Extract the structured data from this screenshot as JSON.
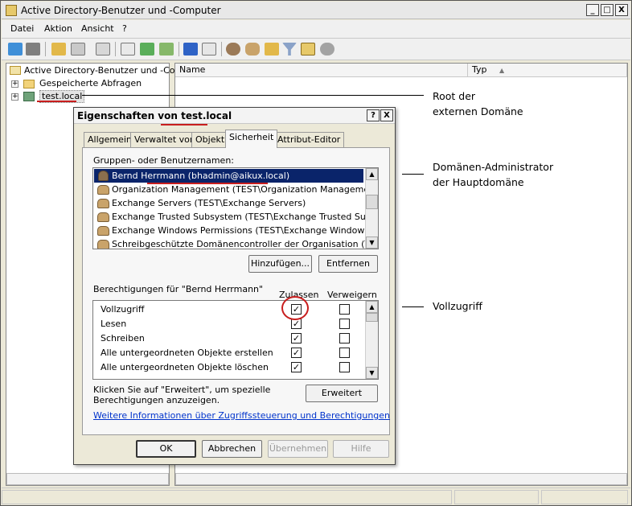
{
  "window": {
    "title": "Active Directory-Benutzer und -Computer",
    "min": "_",
    "max": "□",
    "close": "X"
  },
  "menu": [
    "Datei",
    "Aktion",
    "Ansicht",
    "?"
  ],
  "tree": {
    "root": "Active Directory-Benutzer und -Comp",
    "saved": "Gespeicherte Abfragen",
    "domain": "test.local"
  },
  "list": {
    "col_name": "Name",
    "col_type": "Typ"
  },
  "annotations": {
    "root_line1": "Root der",
    "root_line2": "externen Domäne",
    "admin_line1": "Domänen-Administrator",
    "admin_line2": "der Hauptdomäne",
    "full": "Vollzugriff"
  },
  "dialog": {
    "title": "Eigenschaften von test.local",
    "help": "?",
    "close": "X",
    "tabs": [
      "Allgemein",
      "Verwaltet von",
      "Objekt",
      "Sicherheit",
      "Attribut-Editor"
    ],
    "active_tab": "Sicherheit",
    "users_label": "Gruppen- oder Benutzernamen:",
    "users": [
      {
        "name": "Bernd Herrmann (bhadmin@aikux.local)",
        "kind": "user",
        "selected": true
      },
      {
        "name": "Organization Management (TEST\\Organization Management)",
        "kind": "group"
      },
      {
        "name": "Exchange Servers (TEST\\Exchange Servers)",
        "kind": "group"
      },
      {
        "name": "Exchange Trusted Subsystem (TEST\\Exchange Trusted Subsy...",
        "kind": "group"
      },
      {
        "name": "Exchange Windows Permissions (TEST\\Exchange Windows Pe...",
        "kind": "group"
      },
      {
        "name": "Schreibgeschützte Domänencontroller der Organisation (TEST\\...",
        "kind": "group"
      }
    ],
    "add_button": "Hinzufügen...",
    "remove_button": "Entfernen",
    "perm_label": "Berechtigungen für \"Bernd Herrmann\"",
    "allow_col": "Zulassen",
    "deny_col": "Verweigern",
    "permissions": [
      {
        "name": "Vollzugriff",
        "allow": true,
        "deny": false
      },
      {
        "name": "Lesen",
        "allow": true,
        "deny": false
      },
      {
        "name": "Schreiben",
        "allow": true,
        "deny": false
      },
      {
        "name": "Alle untergeordneten Objekte erstellen",
        "allow": true,
        "deny": false
      },
      {
        "name": "Alle untergeordneten Objekte löschen",
        "allow": true,
        "deny": false
      }
    ],
    "advanced_hint": "Klicken Sie auf \"Erweitert\", um spezielle Berechtigungen anzuzeigen.",
    "advanced_hint_line1": "Klicken Sie auf \"Erweitert\", um spezielle",
    "advanced_hint_line2": "Berechtigungen anzuzeigen.",
    "advanced_button": "Erweitert",
    "info_link": "Weitere Informationen über Zugriffssteuerung und Berechtigungen",
    "ok": "OK",
    "cancel": "Abbrechen",
    "apply": "Übernehmen",
    "help_button": "Hilfe"
  },
  "colors": {
    "annotation_red": "#c81e1e",
    "selection": "#0a246a",
    "link": "#0033cc"
  }
}
